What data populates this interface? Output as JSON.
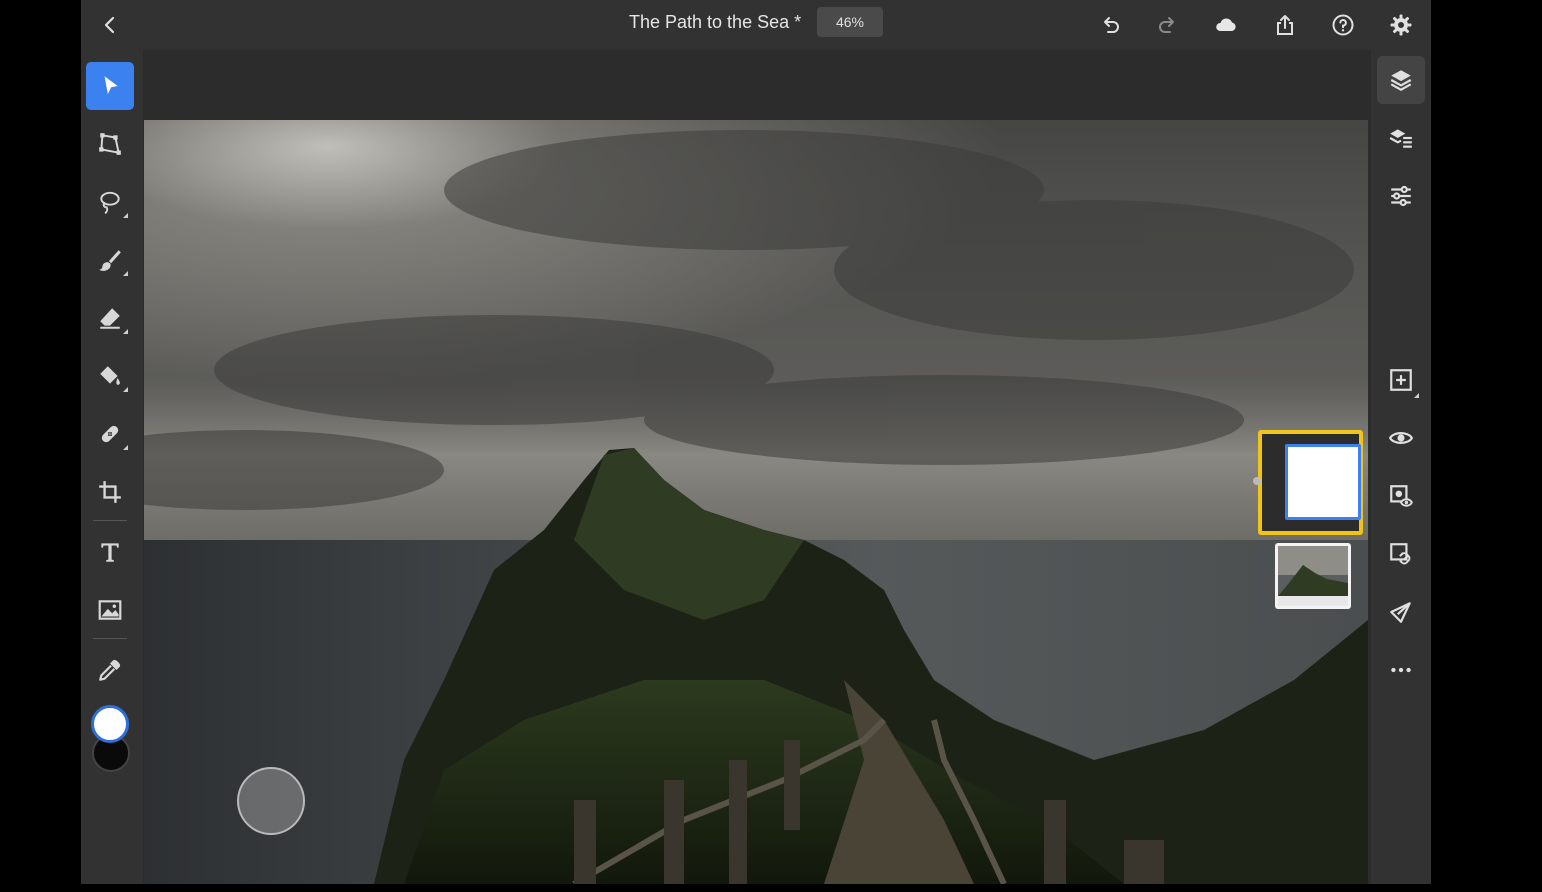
{
  "topbar": {
    "title": "The Path to the Sea *",
    "zoom": "46%",
    "icons": [
      "back-icon",
      "undo-icon",
      "redo-icon",
      "cloud-icon",
      "share-icon",
      "help-icon",
      "settings-icon"
    ]
  },
  "tools": [
    {
      "name": "select-move",
      "icon": "arrow-cursor-icon",
      "active": true
    },
    {
      "name": "transform",
      "icon": "transform-icon"
    },
    {
      "name": "lasso",
      "icon": "lasso-icon"
    },
    {
      "name": "brush",
      "icon": "brush-icon"
    },
    {
      "name": "eraser",
      "icon": "eraser-icon"
    },
    {
      "name": "fill",
      "icon": "paint-bucket-icon"
    },
    {
      "name": "healing",
      "icon": "bandage-icon"
    },
    {
      "name": "crop",
      "icon": "crop-icon"
    },
    {
      "name": "type",
      "icon": "text-icon"
    },
    {
      "name": "place-image",
      "icon": "image-icon"
    },
    {
      "name": "eyedropper",
      "icon": "eyedropper-icon"
    }
  ],
  "colors": {
    "foreground": "#ffffff",
    "background": "#0a0a0a",
    "accent": "#3b82f0",
    "highlight": "#f2c318"
  },
  "right_tools": [
    "layers-icon",
    "layer-properties-icon",
    "adjustments-icon",
    "add-layer-icon",
    "visibility-icon",
    "mask-icon",
    "clipping-icon",
    "selection-icon",
    "more-icon"
  ],
  "layers": [
    "blank-layer",
    "photo-layer"
  ]
}
